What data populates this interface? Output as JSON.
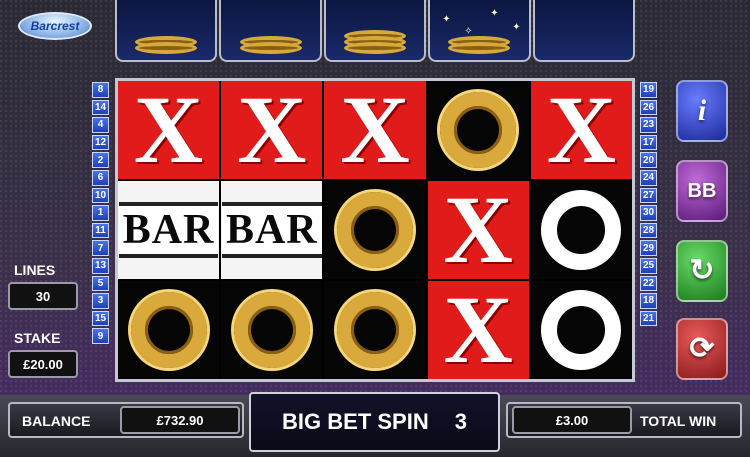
{
  "brand": {
    "logo_text": "Barcrest"
  },
  "top_slots": [
    {
      "icon": "gold-rings-small"
    },
    {
      "icon": "gold-rings-small"
    },
    {
      "icon": "gold-rings-medium"
    },
    {
      "icon": "gold-rings-sparkle"
    },
    {
      "icon": "empty"
    }
  ],
  "paylines": {
    "left": [
      "8",
      "14",
      "4",
      "12",
      "2",
      "6",
      "10",
      "1",
      "11",
      "7",
      "13",
      "5",
      "3",
      "15",
      "9"
    ],
    "right": [
      "19",
      "26",
      "23",
      "17",
      "20",
      "24",
      "27",
      "30",
      "28",
      "29",
      "25",
      "22",
      "18",
      "21"
    ]
  },
  "reels": [
    [
      {
        "symbol": "X",
        "bg": "red"
      },
      {
        "symbol": "X",
        "bg": "red"
      },
      {
        "symbol": "X",
        "bg": "red"
      },
      {
        "symbol": "gold-ring",
        "bg": "black"
      },
      {
        "symbol": "X",
        "bg": "red"
      }
    ],
    [
      {
        "symbol": "BAR",
        "bg": "white"
      },
      {
        "symbol": "BAR",
        "bg": "white"
      },
      {
        "symbol": "gold-ring",
        "bg": "black"
      },
      {
        "symbol": "X",
        "bg": "red"
      },
      {
        "symbol": "white-ring",
        "bg": "black"
      }
    ],
    [
      {
        "symbol": "gold-ring",
        "bg": "black"
      },
      {
        "symbol": "gold-ring",
        "bg": "black"
      },
      {
        "symbol": "gold-ring",
        "bg": "black"
      },
      {
        "symbol": "X",
        "bg": "red"
      },
      {
        "symbol": "white-ring",
        "bg": "black"
      }
    ]
  ],
  "buttons": {
    "info": {
      "icon": "info-icon",
      "glyph": "i"
    },
    "big_bet": {
      "icon": "big-bet-icon",
      "glyph": "BB"
    },
    "spin": {
      "icon": "spin-arrow-icon",
      "glyph": "↻"
    },
    "autoplay": {
      "icon": "autoplay-icon",
      "glyph": "⟳"
    }
  },
  "lines": {
    "label": "LINES",
    "value": "30"
  },
  "stake": {
    "label": "STAKE",
    "value": "£20.00"
  },
  "balance": {
    "label": "BALANCE",
    "value": "£732.90"
  },
  "total_win": {
    "label": "TOTAL WIN",
    "value": "£3.00"
  },
  "big_bet_spin": {
    "label": "BIG BET SPIN",
    "count": "3"
  },
  "colors": {
    "reel_red": "#e11a1a",
    "gold": "#d9a93c",
    "accent_blue": "#1f3fb8"
  }
}
